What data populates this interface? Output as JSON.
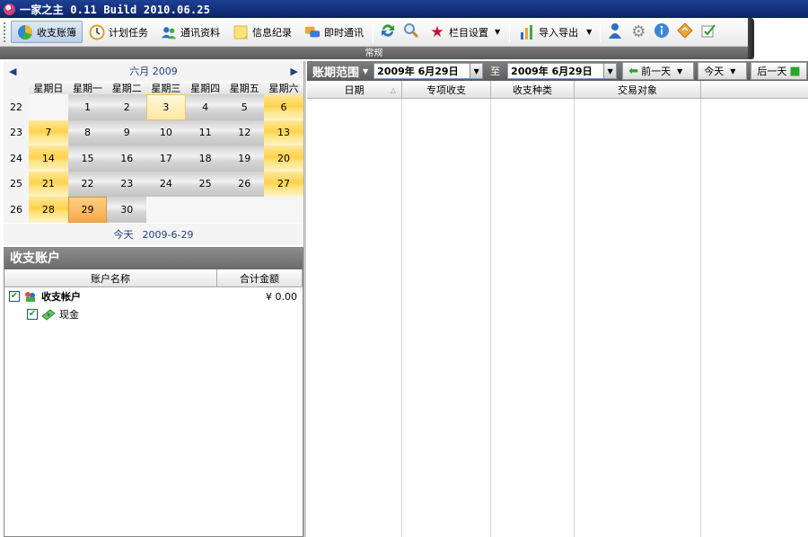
{
  "window": {
    "title": "一家之主 0.11 Build 2010.06.25"
  },
  "toolbar": {
    "items": [
      {
        "label": "收支账簿",
        "icon": "chart-pie-icon",
        "active": true
      },
      {
        "label": "计划任务",
        "icon": "clock-icon"
      },
      {
        "label": "通讯资料",
        "icon": "contacts-icon"
      },
      {
        "label": "信息纪录",
        "icon": "note-icon"
      },
      {
        "label": "即时通讯",
        "icon": "chat-icon"
      }
    ],
    "column_settings": "栏目设置",
    "import_export": "导入导出",
    "group_label": "常规"
  },
  "calendar": {
    "month_label": "六月 2009",
    "weekdays": [
      "星期日",
      "星期一",
      "星期二",
      "星期三",
      "星期四",
      "星期五",
      "星期六"
    ],
    "weeks": [
      {
        "week": "22",
        "days": [
          "",
          "1",
          "2",
          "3",
          "4",
          "5",
          "6"
        ]
      },
      {
        "week": "23",
        "days": [
          "7",
          "8",
          "9",
          "10",
          "11",
          "12",
          "13"
        ]
      },
      {
        "week": "24",
        "days": [
          "14",
          "15",
          "16",
          "17",
          "18",
          "19",
          "20"
        ]
      },
      {
        "week": "25",
        "days": [
          "21",
          "22",
          "23",
          "24",
          "25",
          "26",
          "27"
        ]
      },
      {
        "week": "26",
        "days": [
          "28",
          "29",
          "30",
          "",
          "",
          "",
          ""
        ]
      }
    ],
    "selected_day": "3",
    "today_day": "29",
    "today_label": "今天",
    "today_date": "2009-6-29"
  },
  "accounts": {
    "title": "收支账户",
    "col_name": "账户名称",
    "col_total": "合计金额",
    "rows": [
      {
        "name": "收支帐户",
        "amount": "¥ 0.00",
        "checked": true,
        "bold": true
      },
      {
        "name": "现金",
        "amount": "",
        "checked": true,
        "bold": false
      }
    ]
  },
  "range": {
    "label": "账期范围",
    "from": "2009年  6月29日",
    "to_label": "至",
    "to": "2009年  6月29日",
    "prev": "前一天",
    "today": "今天",
    "next": "后一天"
  },
  "grid": {
    "columns": [
      "日期",
      "专项收支",
      "收支种类",
      "交易对象"
    ]
  },
  "colors": {
    "titlebar": "#0a246a",
    "weekend": "#ffd24a",
    "today": "#f8a94c",
    "panel_header": "#6a6a6a"
  }
}
